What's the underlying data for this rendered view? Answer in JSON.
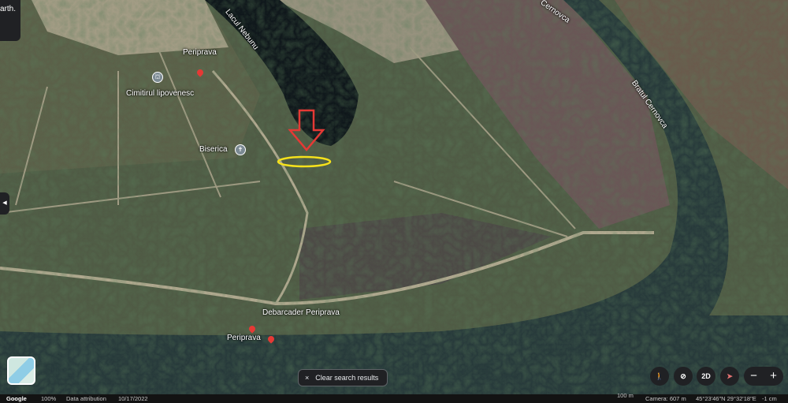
{
  "top_left_panel": {
    "text": "arth."
  },
  "map_labels": {
    "lake": "Lacul Nebunu",
    "village_top": "Periprava",
    "cemetery": "Cimitirul lipovenesc",
    "church": "Biserica",
    "river_top": "Cernovca",
    "river_branch": "Bratul Cernovca",
    "dock": "Debarcader Periprava",
    "village_bottom": "Periprava"
  },
  "annotations": {
    "arrow_color": "#e53935",
    "highlight_color": "#f5e11c"
  },
  "controls": {
    "clear_search": "Clear search results",
    "clear_icon": "×",
    "view_2d": "2D",
    "zoom_out": "−",
    "zoom_in": "+"
  },
  "status_bar": {
    "logo": "Google",
    "zoom": "100%",
    "data_attribution": "Data attribution",
    "date": "10/17/2022",
    "scale": "100 m",
    "camera": "Camera: 607 m",
    "coords": "45°23'46\"N 29°32'18\"E",
    "elevation": "-1 cm"
  }
}
